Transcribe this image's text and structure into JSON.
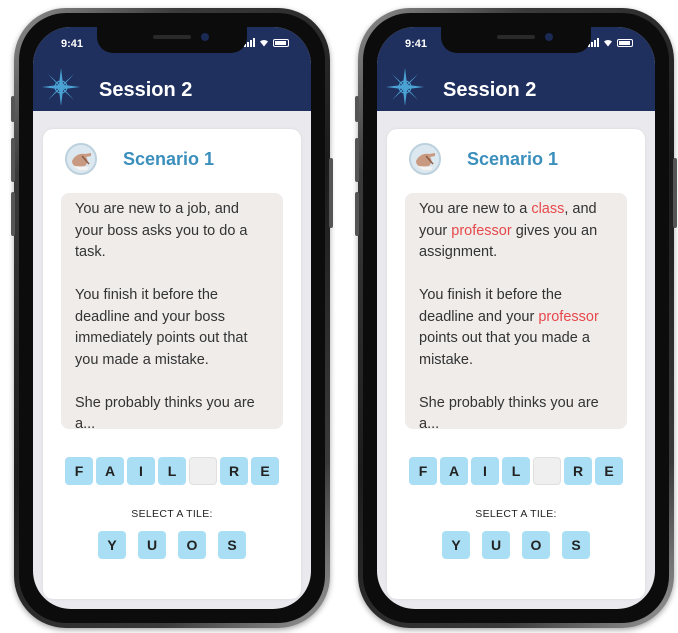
{
  "status_time": "9:41",
  "header_title": "Session 2",
  "scenario_title": "Scenario 1",
  "word_tiles": [
    "F",
    "A",
    "I",
    "L",
    "",
    "R",
    "E"
  ],
  "select_label": "SELECT A TILE:",
  "choice_tiles": [
    "Y",
    "U",
    "O",
    "S"
  ],
  "colors": {
    "header_bg": "#1f2f5e",
    "scenario_title": "#3a8fbd",
    "tile_bg": "#a9def4",
    "highlight": "#e7484b"
  },
  "phones": [
    {
      "story": [
        [
          {
            "t": "You are new to a job, and your boss asks you to do a task."
          }
        ],
        [
          {
            "t": "You finish it before the deadline and your boss immediately points out that you made a mistake."
          }
        ],
        [
          {
            "t": "She probably thinks you are a..."
          }
        ]
      ]
    },
    {
      "story": [
        [
          {
            "t": "You are new to a "
          },
          {
            "t": "class",
            "h": true
          },
          {
            "t": ", and your "
          },
          {
            "t": "professor",
            "h": true
          },
          {
            "t": " gives you an assignment."
          }
        ],
        [
          {
            "t": "You finish it before the deadline and your "
          },
          {
            "t": "professor",
            "h": true
          },
          {
            "t": " points out that you made a mistake."
          }
        ],
        [
          {
            "t": "She probably thinks you are a..."
          }
        ]
      ]
    }
  ]
}
